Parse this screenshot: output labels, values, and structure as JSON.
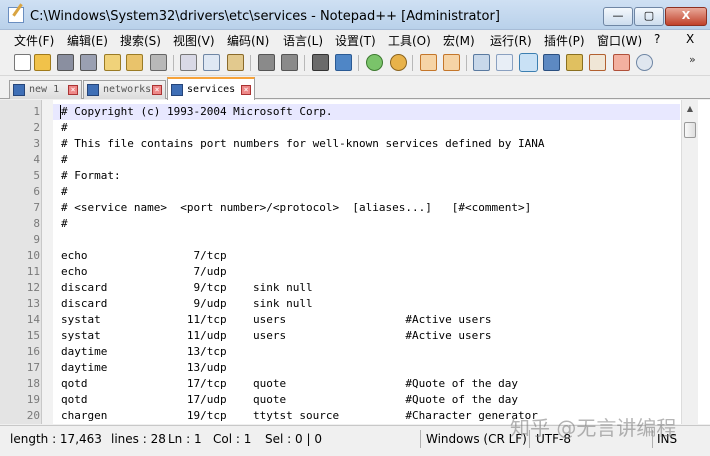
{
  "window": {
    "title": "C:\\Windows\\System32\\drivers\\etc\\services - Notepad++ [Administrator]",
    "minimize": "—",
    "maximize": "▢",
    "close": "X"
  },
  "menu": {
    "items": [
      "文件(F)",
      "编辑(E)",
      "搜索(S)",
      "视图(V)",
      "编码(N)",
      "语言(L)",
      "设置(T)",
      "工具(O)",
      "宏(M)",
      "运行(R)",
      "插件(P)",
      "窗口(W)",
      "?"
    ],
    "close_doc": "X"
  },
  "toolbar": {
    "icons": [
      "new-file-icon",
      "open-file-icon",
      "save-icon",
      "save-all-icon",
      "close-icon",
      "close-all-icon",
      "print-icon",
      "cut-icon",
      "copy-icon",
      "paste-icon",
      "undo-icon",
      "redo-icon",
      "find-icon",
      "replace-icon",
      "zoom-in-icon",
      "zoom-out-icon",
      "sync-v-icon",
      "sync-h-icon",
      "word-wrap-icon",
      "show-all-chars-icon",
      "indent-guide-icon",
      "user-lang-icon",
      "doc-map-icon",
      "function-list-icon",
      "folder-workspace-icon",
      "monitor-icon"
    ],
    "overflow": "»"
  },
  "tabs": [
    {
      "label": "new 1",
      "active": false
    },
    {
      "label": "networks",
      "active": false
    },
    {
      "label": "services",
      "active": true
    }
  ],
  "editor": {
    "lines": [
      {
        "n": "1",
        "text": "# Copyright (c) 1993-2004 Microsoft Corp."
      },
      {
        "n": "2",
        "text": "#"
      },
      {
        "n": "3",
        "text": "# This file contains port numbers for well-known services defined by IANA"
      },
      {
        "n": "4",
        "text": "#"
      },
      {
        "n": "5",
        "text": "# Format:"
      },
      {
        "n": "6",
        "text": "#"
      },
      {
        "n": "7",
        "text": "# <service name>  <port number>/<protocol>  [aliases...]   [#<comment>]"
      },
      {
        "n": "8",
        "text": "#"
      },
      {
        "n": "9",
        "text": ""
      },
      {
        "n": "10",
        "text": "echo                7/tcp"
      },
      {
        "n": "11",
        "text": "echo                7/udp"
      },
      {
        "n": "12",
        "text": "discard             9/tcp    sink null"
      },
      {
        "n": "13",
        "text": "discard             9/udp    sink null"
      },
      {
        "n": "14",
        "text": "systat             11/tcp    users                  #Active users"
      },
      {
        "n": "15",
        "text": "systat             11/udp    users                  #Active users"
      },
      {
        "n": "16",
        "text": "daytime            13/tcp"
      },
      {
        "n": "17",
        "text": "daytime            13/udp"
      },
      {
        "n": "18",
        "text": "qotd               17/tcp    quote                  #Quote of the day"
      },
      {
        "n": "19",
        "text": "qotd               17/udp    quote                  #Quote of the day"
      },
      {
        "n": "20",
        "text": "chargen            19/tcp    ttytst source          #Character generator"
      }
    ]
  },
  "status": {
    "length": "length : 17,463",
    "lines": "lines : 28",
    "ln": "Ln : 1",
    "col": "Col : 1",
    "sel": "Sel : 0 | 0",
    "eol": "Windows (CR LF)",
    "encoding": "UTF-8",
    "mode": "INS"
  },
  "watermark": "知乎 @无言讲编程"
}
